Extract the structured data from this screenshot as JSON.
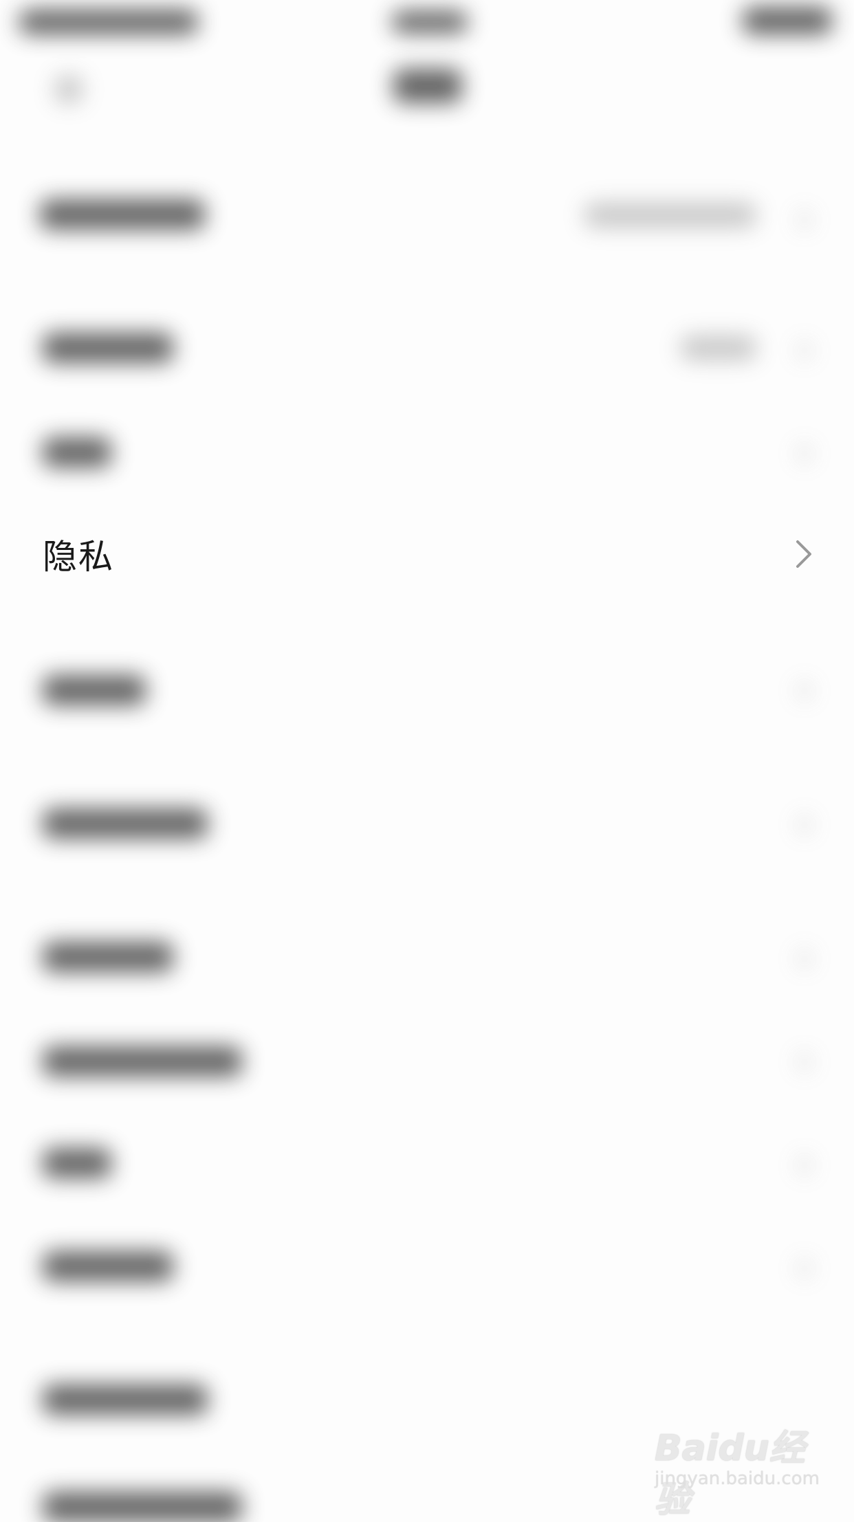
{
  "settings_list": {
    "privacy_item": {
      "label": "隐私",
      "icon": "chevron-right-icon"
    }
  },
  "watermark": {
    "logo": "Baidu经验",
    "url": "jingyan.baidu.com"
  },
  "colors": {
    "background": "#fdfdfd",
    "text": "#1a1a1a",
    "chevron": "#999999"
  }
}
